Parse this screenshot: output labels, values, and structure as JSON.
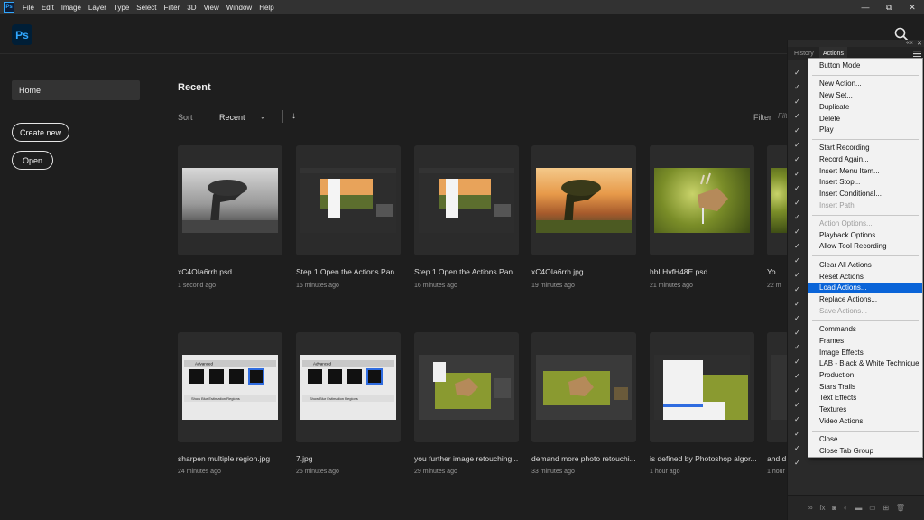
{
  "menubar": {
    "logo": "Ps",
    "items": [
      "File",
      "Edit",
      "Image",
      "Layer",
      "Type",
      "Select",
      "Filter",
      "3D",
      "View",
      "Window",
      "Help"
    ],
    "controls": {
      "minimize": "—",
      "restore": "⧉",
      "close": "✕"
    }
  },
  "header": {
    "logo": "Ps",
    "search_icon": "search-icon"
  },
  "sidebar": {
    "home": "Home",
    "create_new": "Create new",
    "open": "Open"
  },
  "main": {
    "title": "Recent",
    "sort_label": "Sort",
    "sort_value": "Recent",
    "sort_direction_icon": "↓",
    "filter_label": "Filter",
    "filter_placeholder": "Filt"
  },
  "files_row1": [
    {
      "name": "xC4OIa6rrh.psd",
      "time": "1 second ago",
      "thumb": "bw"
    },
    {
      "name": "Step 1 Open the Actions Pane...",
      "time": "16 minutes ago",
      "thumb": "screen"
    },
    {
      "name": "Step 1 Open the Actions Pane...",
      "time": "16 minutes ago",
      "thumb": "screen"
    },
    {
      "name": "xC4OIa6rrh.jpg",
      "time": "19 minutes ago",
      "thumb": "color"
    },
    {
      "name": "hbLHvfH48E.psd",
      "time": "21 minutes ago",
      "thumb": "deer"
    },
    {
      "name": "You m",
      "time": "22 m",
      "thumb": "deer"
    }
  ],
  "files_row2": [
    {
      "name": "sharpen multiple region.jpg",
      "time": "24 minutes ago",
      "thumb": "adv"
    },
    {
      "name": "7.jpg",
      "time": "25 minutes ago",
      "thumb": "adv"
    },
    {
      "name": "you further image retouching...",
      "time": "29 minutes ago",
      "thumb": "photo-ui"
    },
    {
      "name": "demand more photo retouchi...",
      "time": "33 minutes ago",
      "thumb": "photo-ui"
    },
    {
      "name": "is defined by Photoshop algor...",
      "time": "1 hour ago",
      "thumb": "menu-ui"
    },
    {
      "name": "and d",
      "time": "1 hour",
      "thumb": "screen"
    }
  ],
  "thumb_text": {
    "advanced": "Advanced",
    "show_blur": "Show Blur Estimation Regions"
  },
  "panel": {
    "tab_history": "History",
    "tab_actions": "Actions",
    "collapse": "««",
    "close": "✕",
    "bottom_icons": [
      "∞",
      "fx",
      "◙",
      "◐",
      "▬",
      "▭",
      "⊞",
      "🗑"
    ]
  },
  "actions_menu": [
    {
      "label": "Button Mode",
      "state": "normal"
    },
    {
      "label": "New Action...",
      "state": "normal"
    },
    {
      "label": "New Set...",
      "state": "normal"
    },
    {
      "label": "Duplicate",
      "state": "normal"
    },
    {
      "label": "Delete",
      "state": "normal"
    },
    {
      "label": "Play",
      "state": "normal"
    },
    {
      "label": "Start Recording",
      "state": "normal"
    },
    {
      "label": "Record Again...",
      "state": "normal"
    },
    {
      "label": "Insert Menu Item...",
      "state": "normal"
    },
    {
      "label": "Insert Stop...",
      "state": "normal"
    },
    {
      "label": "Insert Conditional...",
      "state": "normal"
    },
    {
      "label": "Insert Path",
      "state": "disabled"
    },
    {
      "label": "Action Options...",
      "state": "disabled"
    },
    {
      "label": "Playback Options...",
      "state": "normal"
    },
    {
      "label": "Allow Tool Recording",
      "state": "normal"
    },
    {
      "label": "Clear All Actions",
      "state": "normal"
    },
    {
      "label": "Reset Actions",
      "state": "normal"
    },
    {
      "label": "Load Actions...",
      "state": "highlight"
    },
    {
      "label": "Replace Actions...",
      "state": "normal"
    },
    {
      "label": "Save Actions...",
      "state": "disabled"
    },
    {
      "label": "Commands",
      "state": "normal"
    },
    {
      "label": "Frames",
      "state": "normal"
    },
    {
      "label": "Image Effects",
      "state": "normal"
    },
    {
      "label": "LAB - Black & White Technique",
      "state": "normal"
    },
    {
      "label": "Production",
      "state": "normal"
    },
    {
      "label": "Stars Trails",
      "state": "normal"
    },
    {
      "label": "Text Effects",
      "state": "normal"
    },
    {
      "label": "Textures",
      "state": "normal"
    },
    {
      "label": "Video Actions",
      "state": "normal"
    },
    {
      "label": "Close",
      "state": "normal"
    },
    {
      "label": "Close Tab Group",
      "state": "normal"
    }
  ],
  "colors": {
    "accent": "#31a8ff",
    "highlight": "#0a64d8",
    "background": "#1e1e1e"
  }
}
